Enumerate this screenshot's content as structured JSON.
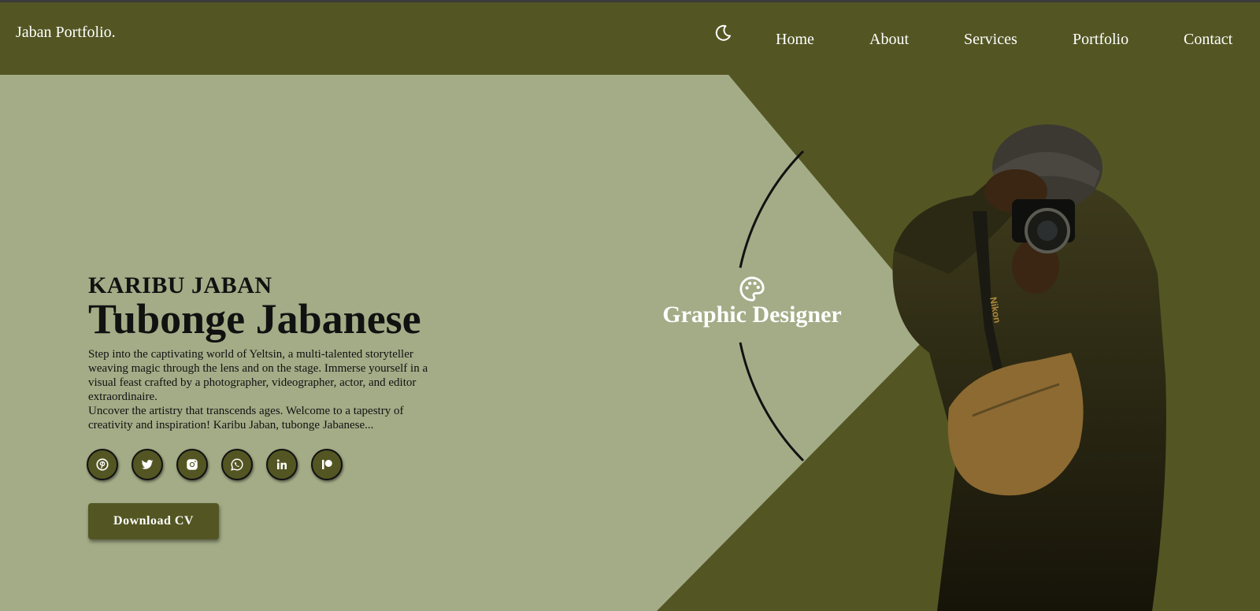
{
  "header": {
    "logo": "Jaban Portfolio.",
    "theme_icon": "moon-icon",
    "nav": [
      "Home",
      "About",
      "Services",
      "Portfolio",
      "Contact"
    ]
  },
  "hero": {
    "kicker": "KARIBU JABAN",
    "headline": "Tubonge Jabanese",
    "description": "Step into the captivating world of Yeltsin, a multi-talented storyteller weaving magic through the lens and on the stage. Immerse yourself in a visual feast crafted by a photographer, videographer, actor, and editor extraordinaire.",
    "description2": "Uncover the artistry that transcends ages. Welcome to a tapestry of creativity and inspiration! Karibu Jaban, tubonge Jabanese...",
    "socials": [
      "pinterest-icon",
      "twitter-icon",
      "instagram-icon",
      "whatsapp-icon",
      "linkedin-icon",
      "patreon-icon"
    ],
    "cta": "Download CV",
    "role_icon": "palette-icon",
    "role": "Graphic Designer",
    "camera_brand": "Nikon"
  },
  "colors": {
    "olive": "#535623",
    "sage": "#a4ac87",
    "text": "#111111",
    "white": "#ffffff"
  }
}
